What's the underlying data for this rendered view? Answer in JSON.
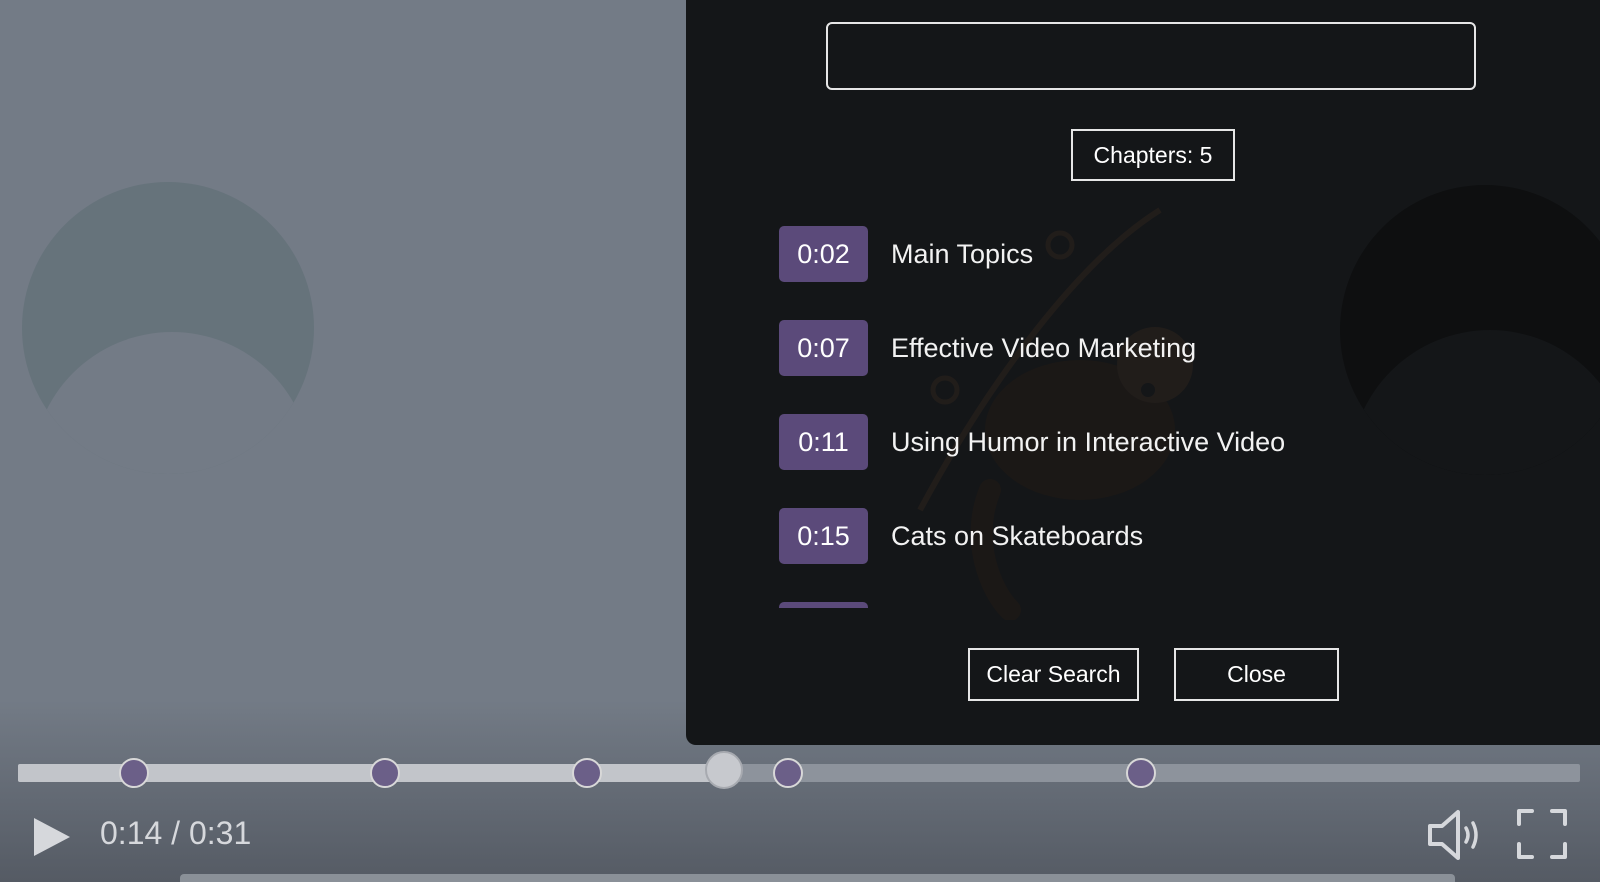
{
  "search": {
    "value": "",
    "placeholder": ""
  },
  "chapters_panel": {
    "count_label": "Chapters: 5",
    "chapters": [
      {
        "time": "0:02",
        "title": "Main Topics"
      },
      {
        "time": "0:07",
        "title": "Effective Video Marketing"
      },
      {
        "time": "0:11",
        "title": "Using Humor in Interactive Video"
      },
      {
        "time": "0:15",
        "title": "Cats on Skateboards"
      },
      {
        "time": "",
        "title": ""
      }
    ],
    "clear_search_label": "Clear Search",
    "close_label": "Close"
  },
  "player": {
    "time_display": "0:14 / 0:31",
    "current_seconds": 14,
    "duration_seconds": 31,
    "progress_fraction": 0.452,
    "chapter_markers_fraction": [
      0.074,
      0.235,
      0.364,
      0.493,
      0.719
    ],
    "play_icon": "play-icon",
    "volume_icon": "volume-icon",
    "fullscreen_icon": "fullscreen-icon"
  },
  "colors": {
    "panel_bg": "#141618",
    "accent": "#5b4a7a",
    "marker": "#6b5f88",
    "track": "#8d939c",
    "played": "#c2c5ca"
  }
}
